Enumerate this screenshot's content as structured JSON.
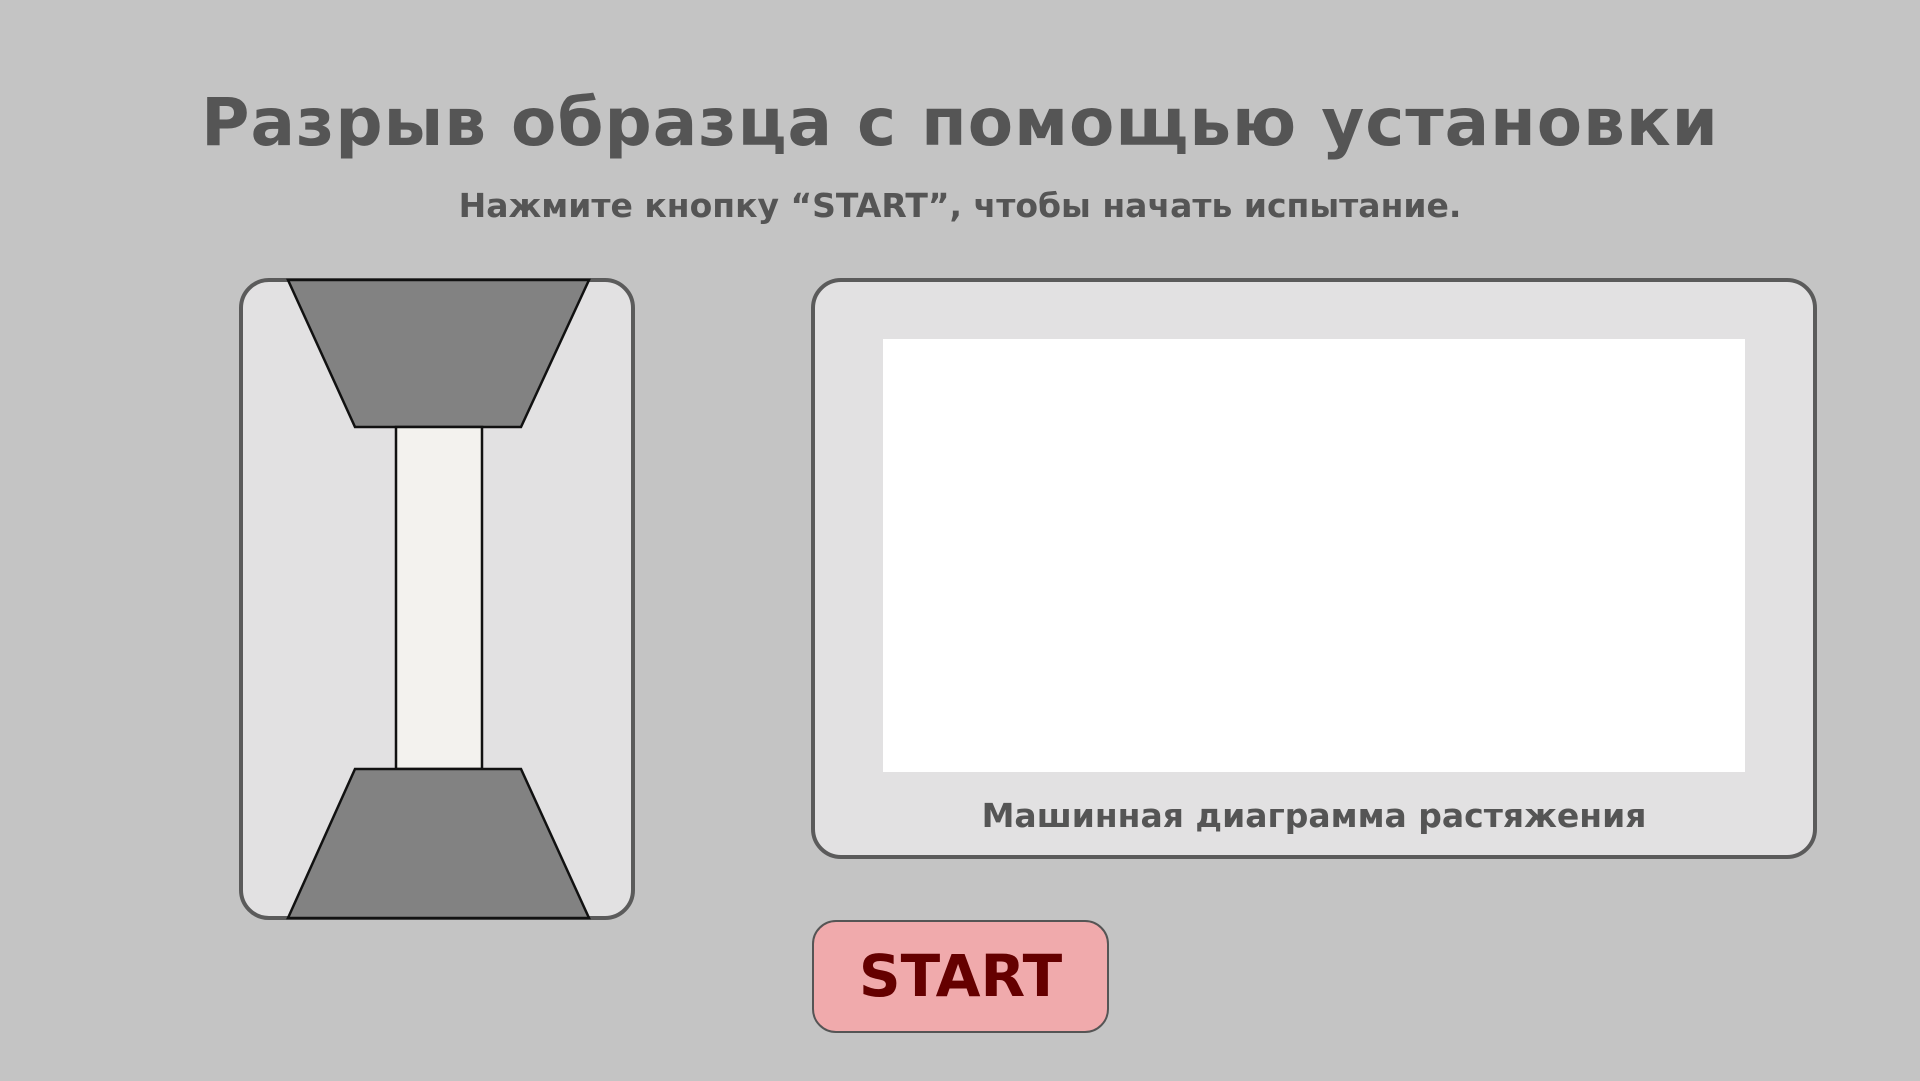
{
  "header": {
    "title": "Разрыв образца с помощью установки",
    "instruction": "Нажмите кнопку “START”, чтобы начать испытание."
  },
  "machine": {
    "grip_color": "#828282",
    "specimen_color": "#f3f2ee"
  },
  "diagram": {
    "caption": "Машинная диаграмма растяжения"
  },
  "controls": {
    "start_label": "START",
    "start_color": "#f0aaac",
    "start_text_color": "#650000"
  }
}
